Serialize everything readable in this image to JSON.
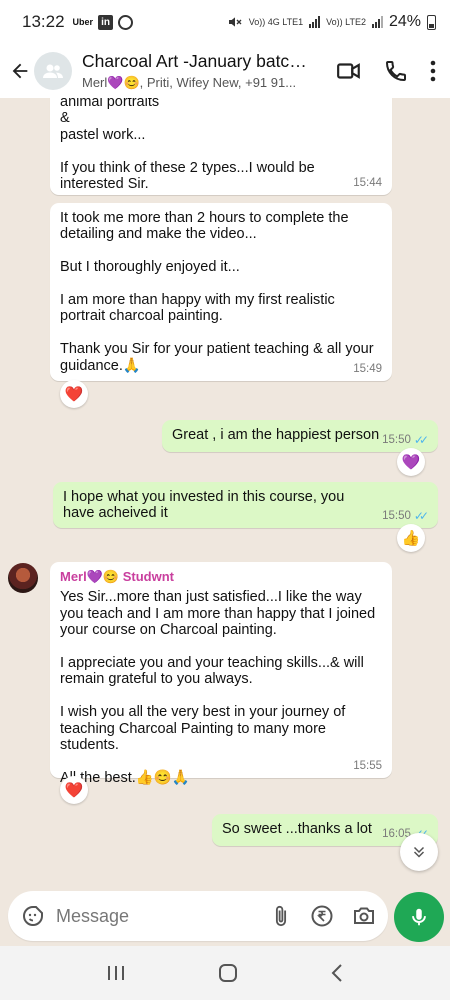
{
  "status": {
    "time": "13:22",
    "uber": "Uber",
    "linkedin": "in",
    "battery": "24%",
    "lte1": "Vo)) 4G LTE1",
    "lte2": "Vo)) LTE2"
  },
  "header": {
    "title": "Charcoal Art -January batch...",
    "members": "Merl💜😊, Priti, Wifey New, +91 91..."
  },
  "messages": [
    {
      "text": "animal portraits\n&\npastel work...\n\nIf you think of these 2 types...I would be interested Sir.",
      "time": "15:44"
    },
    {
      "text": "It took me more than 2 hours to complete the detailing and make the video...\n\nBut I thoroughly enjoyed it...\n\nI am more than happy with my first realistic portrait charcoal painting.\n\nThank you Sir for your patient teaching & all your guidance.🙏",
      "time": "15:49",
      "reaction": "❤️"
    },
    {
      "text": "Great , i am the happiest person",
      "time": "15:50",
      "reaction": "💜"
    },
    {
      "text": "I hope what you invested in this course, you have acheived it",
      "time": "15:50",
      "reaction": "👍"
    },
    {
      "sender": "Merl💜😊 Studwnt",
      "text": "Yes Sir...more than just satisfied...I like the way you teach and I am more than happy that I joined your course on Charcoal painting.\n\nI appreciate you and your teaching skills...& will remain grateful to you always.\n\nI wish you all the very best in your journey of teaching Charcoal Painting to many more students.\n\nAll the best.👍😊🙏",
      "time": "15:55",
      "reaction": "❤️"
    },
    {
      "text": "So sweet ...thanks a lot",
      "time": "16:05"
    }
  ],
  "input": {
    "placeholder": "Message"
  },
  "icons": {
    "back": "arrow-back-icon",
    "group": "group-avatar-icon",
    "video": "video-call-icon",
    "call": "phone-icon",
    "menu": "more-vert-icon",
    "sticker": "sticker-icon",
    "attach": "attach-icon",
    "payment": "rupee-icon",
    "camera": "camera-icon",
    "mic": "mic-icon",
    "scroll": "scroll-down-icon"
  },
  "colors": {
    "incoming": "#ffffff",
    "outgoing": "#dcf8c6",
    "accent": "#1fa855",
    "sender": "#c93f9e",
    "read_ticks": "#4fb6ec"
  }
}
